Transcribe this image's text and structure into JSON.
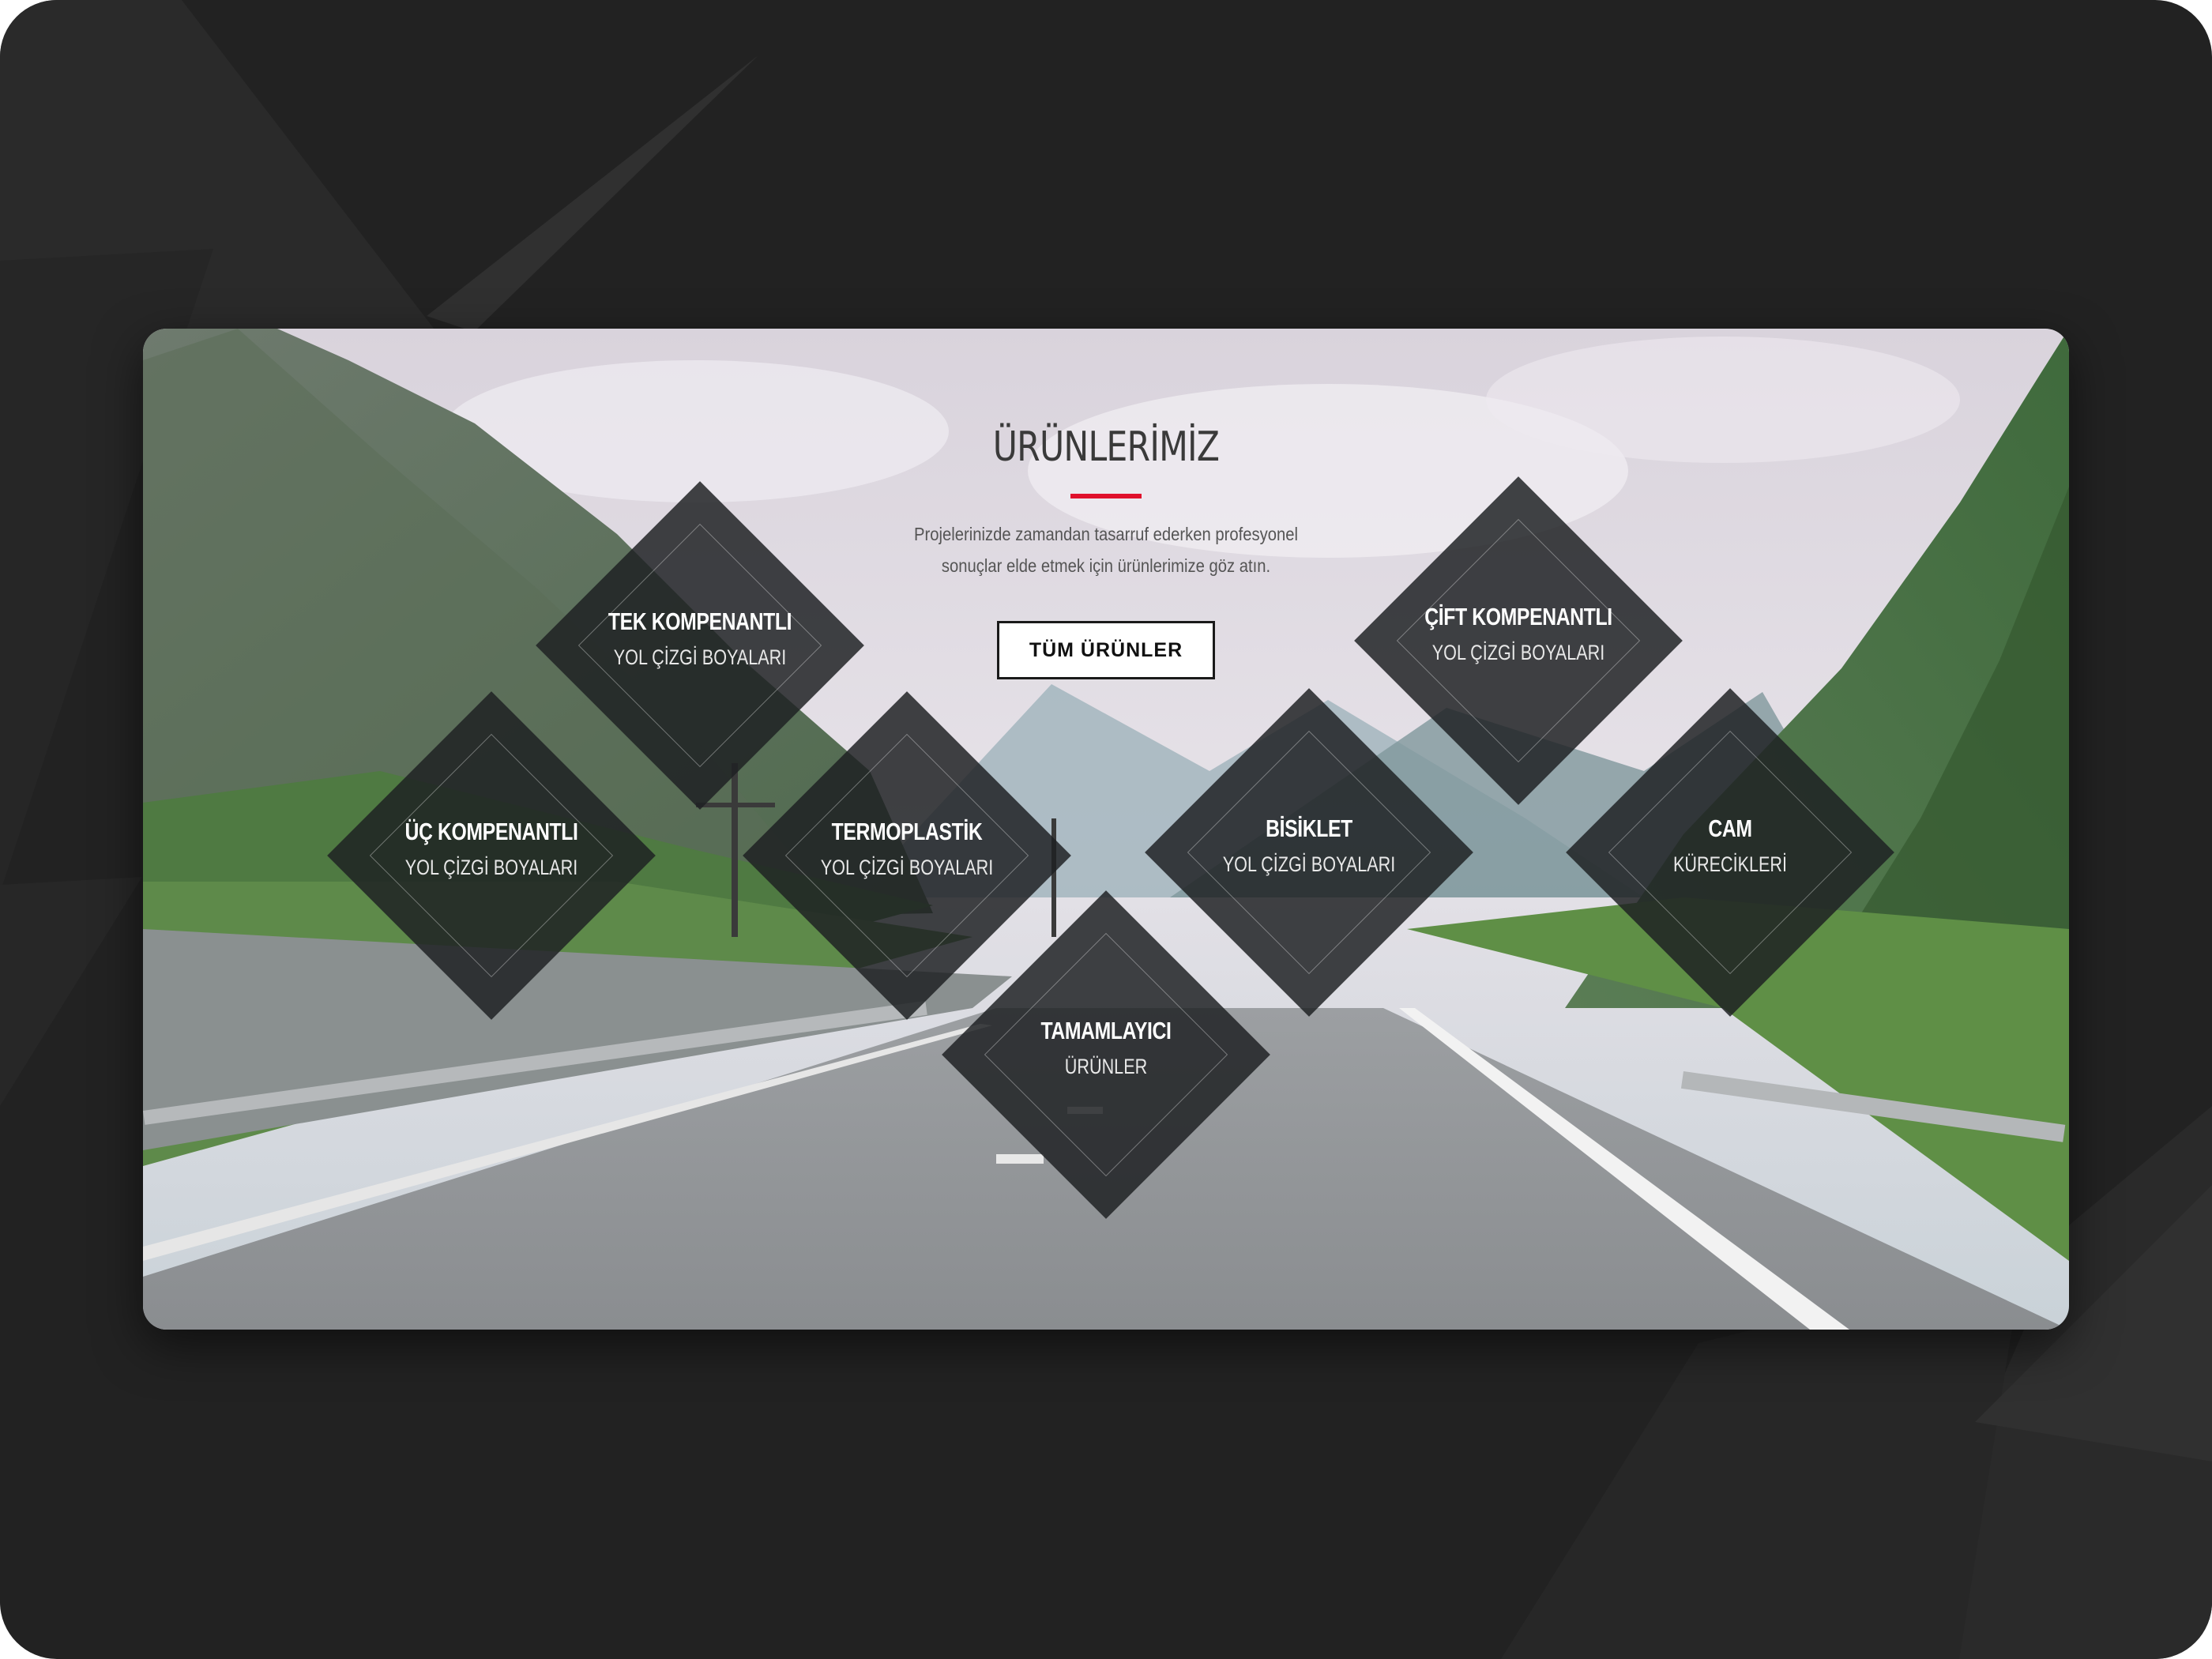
{
  "section": {
    "title": "ÜRÜNLERİMİZ",
    "intro_line1": "Projelerinizde zamandan tasarruf ederken profesyonel",
    "intro_line2": "sonuçlar elde etmek için ürünlerimize göz atın.",
    "button_label": "TÜM ÜRÜNLER"
  },
  "products": [
    {
      "title": "TEK KOMPENANTLI",
      "subtitle": "YOL ÇİZGİ BOYALARI"
    },
    {
      "title": "ÇİFT KOMPENANTLI",
      "subtitle": "YOL ÇİZGİ BOYALARI"
    },
    {
      "title": "ÜÇ KOMPENANTLI",
      "subtitle": "YOL ÇİZGİ BOYALARI"
    },
    {
      "title": "TERMOPLASTİK",
      "subtitle": "YOL ÇİZGİ BOYALARI"
    },
    {
      "title": "BİSİKLET",
      "subtitle": "YOL ÇİZGİ BOYALARI"
    },
    {
      "title": "CAM",
      "subtitle": "KÜRECİKLERİ"
    },
    {
      "title": "TAMAMLAYICI",
      "subtitle": "ÜRÜNLER"
    }
  ],
  "colors": {
    "frame_background": "#222222",
    "accent": "#e0102c",
    "tile_fill": "#1e2022",
    "button_background": "#ffffff"
  }
}
